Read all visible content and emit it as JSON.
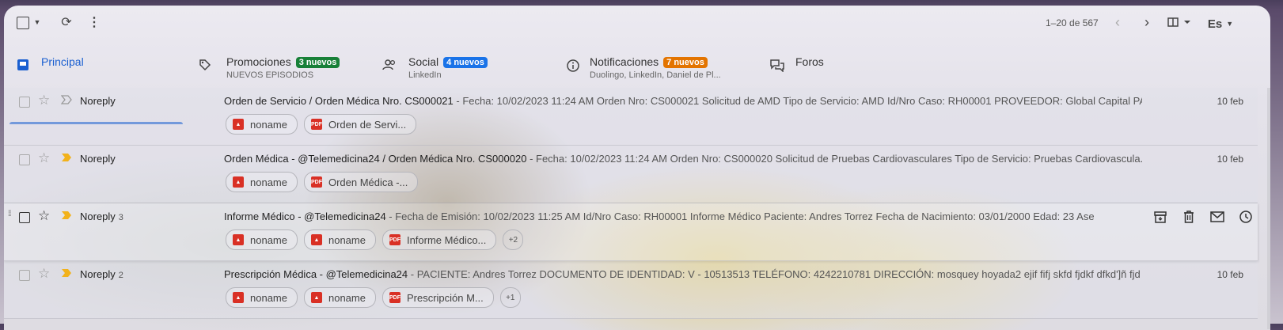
{
  "toolbar": {
    "pager": "1–20 de 567",
    "lang": "Es"
  },
  "tabs": [
    {
      "label": "Principal",
      "sub": "",
      "badge": "",
      "badge_color": ""
    },
    {
      "label": "Promociones",
      "sub": "NUEVOS EPISODIOS",
      "badge": "3 nuevos",
      "badge_color": "#188038"
    },
    {
      "label": "Social",
      "sub": "LinkedIn",
      "badge": "4 nuevos",
      "badge_color": "#1a73e8"
    },
    {
      "label": "Notificaciones",
      "sub": "Duolingo, LinkedIn, Daniel de Pl...",
      "badge": "7 nuevos",
      "badge_color": "#e37400"
    },
    {
      "label": "Foros",
      "sub": "",
      "badge": "",
      "badge_color": ""
    }
  ],
  "emails": [
    {
      "sender": "Noreply",
      "count": "",
      "subject": "Orden de Servicio / Orden Médica Nro. CS000021",
      "snippet": " - Fecha: 10/02/2023 11:24 AM Orden Nro: CS000021 Solicitud de AMD Tipo de Servicio: AMD Id/Nro Caso: RH00001 PROVEEDOR: Global Capital PACI...",
      "date": "10 feb",
      "att": [
        "noname",
        "Orden de Servi..."
      ],
      "more": ""
    },
    {
      "sender": "Noreply",
      "count": "",
      "subject": "Orden Médica - @Telemedicina24 / Orden Médica Nro. CS000020",
      "snippet": " - Fecha: 10/02/2023 11:24 AM Orden Nro: CS000020 Solicitud de Pruebas Cardiovasculares Tipo de Servicio: Pruebas Cardiovascula...",
      "date": "10 feb",
      "att": [
        "noname",
        "Orden Médica -..."
      ],
      "more": ""
    },
    {
      "sender": "Noreply",
      "count": "3",
      "subject": "Informe Médico - @Telemedicina24",
      "snippet": " - Fecha de Emisión: 10/02/2023 11:25 AM Id/Nro Caso: RH00001 Informe Médico Paciente: Andres Torrez Fecha de Nacimiento: 03/01/2000 Edad: 23 Ase...",
      "date": "",
      "att": [
        "noname",
        "noname",
        "Informe Médico..."
      ],
      "more": "+2"
    },
    {
      "sender": "Noreply",
      "count": "2",
      "subject": "Prescripción Médica - @Telemedicina24",
      "snippet": " - PACIENTE: Andres Torrez DOCUMENTO DE IDENTIDAD: V - 10513513 TELÉFONO: 4242210781 DIRECCIÓN: mosquey hoyada2 ejif fifj skfd fjdkf dfkd']ñ fjd fdjkfd...",
      "date": "10 feb",
      "att": [
        "noname",
        "noname",
        "Prescripción M..."
      ],
      "more": "+1"
    }
  ],
  "pdf_label": "PDF",
  "colors": {
    "accent": "#1a5fd0",
    "important": "#f2b21b"
  }
}
